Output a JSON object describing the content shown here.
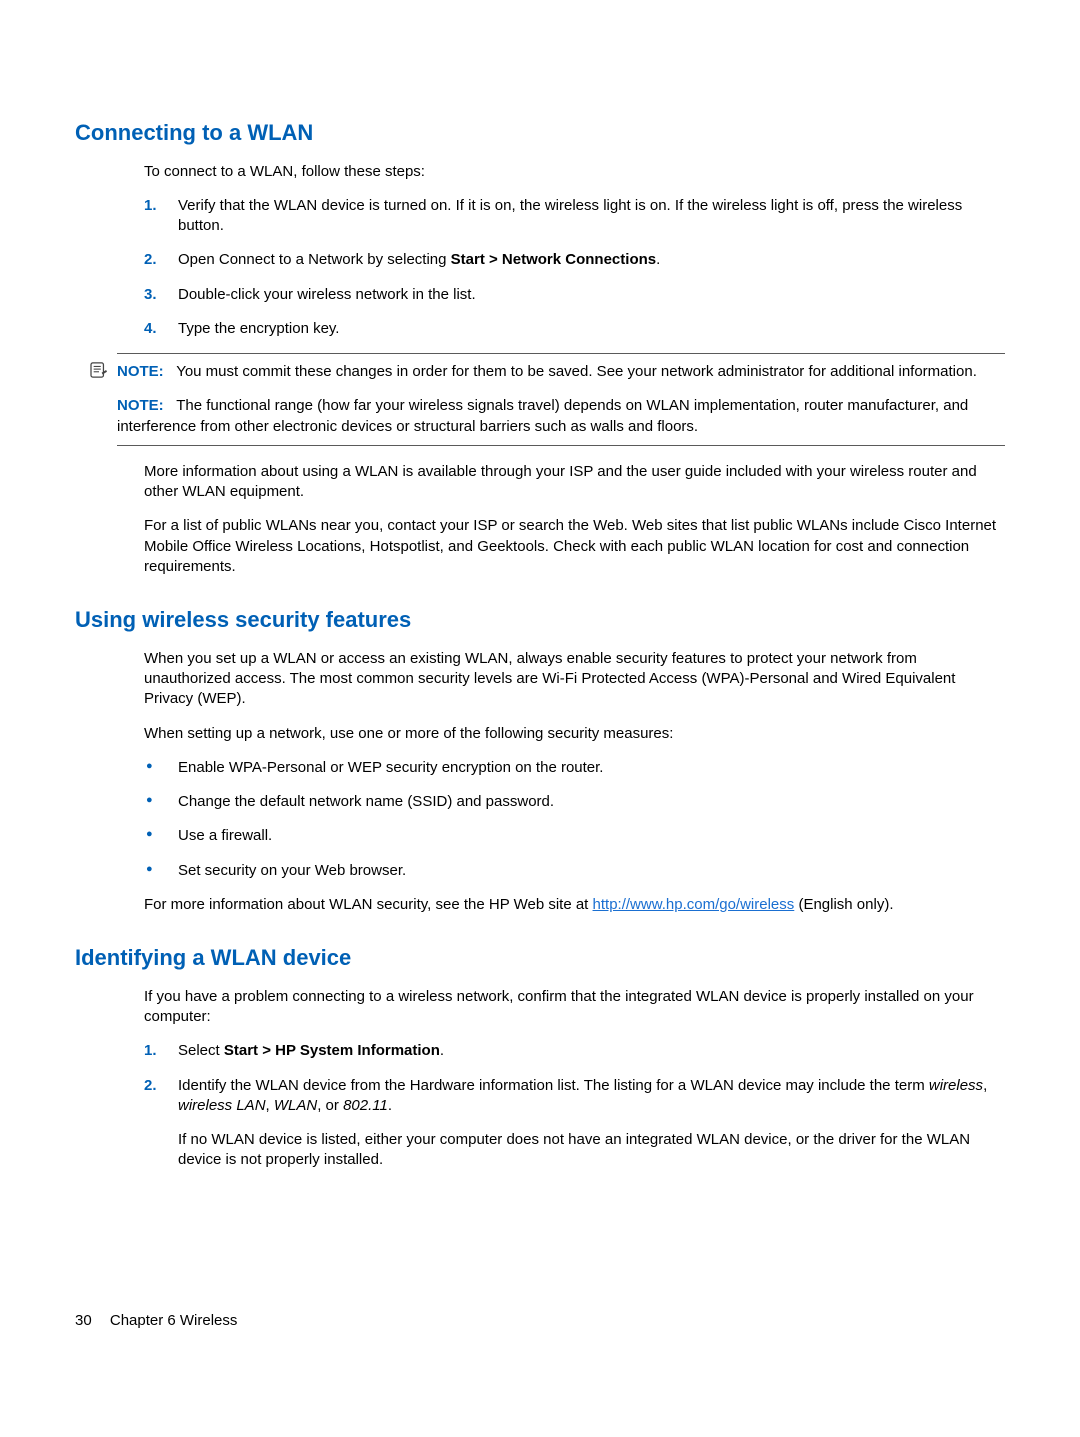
{
  "section1": {
    "heading": "Connecting to a WLAN",
    "intro": "To connect to a WLAN, follow these steps:",
    "steps": [
      "Verify that the WLAN device is turned on. If it is on, the wireless light is on. If the wireless light is off, press the wireless button.",
      "",
      "Double-click your wireless network in the list.",
      "Type the encryption key."
    ],
    "step2_prefix": "Open Connect to a Network by selecting ",
    "step2_bold": "Start > Network Connections",
    "step2_suffix": ".",
    "note1_label": "NOTE:",
    "note1_text": "You must commit these changes in order for them to be saved. See your network administrator for additional information.",
    "note2_label": "NOTE:",
    "note2_text": "The functional range (how far your wireless signals travel) depends on WLAN implementation, router manufacturer, and interference from other electronic devices or structural barriers such as walls and floors.",
    "para_more": "More information about using a WLAN is available through your ISP and the user guide included with your wireless router and other WLAN equipment.",
    "para_public": "For a list of public WLANs near you, contact your ISP or search the Web. Web sites that list public WLANs include Cisco Internet Mobile Office Wireless Locations, Hotspotlist, and Geektools. Check with each public WLAN location for cost and connection requirements."
  },
  "section2": {
    "heading": "Using wireless security features",
    "para1": "When you set up a WLAN or access an existing WLAN, always enable security features to protect your network from unauthorized access. The most common security levels are Wi-Fi Protected Access (WPA)-Personal and Wired Equivalent Privacy (WEP).",
    "para2": "When setting up a network, use one or more of the following security measures:",
    "bullets": [
      "Enable WPA-Personal or WEP security encryption on the router.",
      "Change the default network name (SSID) and password.",
      "Use a firewall.",
      "Set security on your Web browser."
    ],
    "para3_prefix": "For more information about WLAN security, see the HP Web site at ",
    "para3_link": "http://www.hp.com/go/wireless",
    "para3_suffix": " (English only)."
  },
  "section3": {
    "heading": "Identifying a WLAN device",
    "intro": "If you have a problem connecting to a wireless network, confirm that the integrated WLAN device is properly installed on your computer:",
    "step1_prefix": "Select ",
    "step1_bold": "Start > HP System Information",
    "step1_suffix": ".",
    "step2_prefix": "Identify the WLAN device from the Hardware information list. The listing for a WLAN device may include the term ",
    "step2_i1": "wireless",
    "step2_c1": ", ",
    "step2_i2": "wireless LAN",
    "step2_c2": ", ",
    "step2_i3": "WLAN",
    "step2_c3": ", or ",
    "step2_i4": "802.11",
    "step2_c4": ".",
    "step2_sub": "If no WLAN device is listed, either your computer does not have an integrated WLAN device, or the driver for the WLAN device is not properly installed."
  },
  "footer": {
    "page": "30",
    "chapter": "Chapter 6   Wireless"
  }
}
